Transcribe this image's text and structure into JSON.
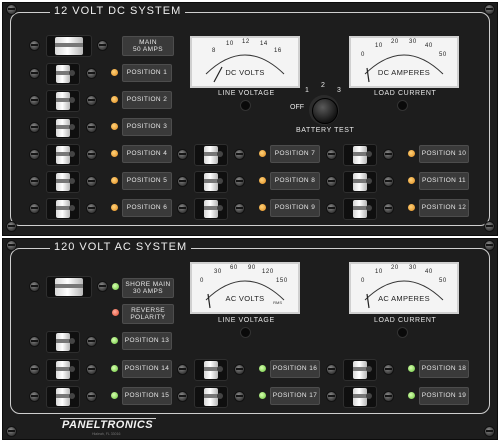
{
  "dc": {
    "title": "12 VOLT DC SYSTEM",
    "main_label_1": "MAIN",
    "main_label_2": "50 AMPS",
    "positions": [
      "POSITION 1",
      "POSITION 2",
      "POSITION 3",
      "POSITION 4",
      "POSITION 5",
      "POSITION 6",
      "POSITION 7",
      "POSITION 8",
      "POSITION 9",
      "POSITION 10",
      "POSITION 11",
      "POSITION 12"
    ],
    "volt_meter": {
      "unit": "DC VOLTS",
      "ticks": [
        "8",
        "10",
        "12",
        "14",
        "16"
      ],
      "caption": "LINE VOLTAGE"
    },
    "amp_meter": {
      "unit": "DC AMPERES",
      "ticks": [
        "0",
        "10",
        "20",
        "30",
        "40",
        "50"
      ],
      "caption": "LOAD CURRENT"
    },
    "battery_test": {
      "caption": "BATTERY TEST",
      "off": "OFF",
      "p1": "1",
      "p2": "2",
      "p3": "3"
    }
  },
  "ac": {
    "title": "120 VOLT AC SYSTEM",
    "shore_1": "SHORE MAIN",
    "shore_2": "30 AMPS",
    "rev_1": "REVERSE",
    "rev_2": "POLARITY",
    "positions": [
      "POSITION 13",
      "POSITION 14",
      "POSITION 15",
      "POSITION 16",
      "POSITION 17",
      "POSITION 18",
      "POSITION 19"
    ],
    "volt_meter": {
      "unit": "AC VOLTS",
      "ticks": [
        "0",
        "30",
        "60",
        "90",
        "120",
        "150"
      ],
      "rms": "RMS",
      "caption": "LINE VOLTAGE"
    },
    "amp_meter": {
      "unit": "AC AMPERES",
      "ticks": [
        "0",
        "10",
        "20",
        "30",
        "40",
        "50"
      ],
      "caption": "LOAD CURRENT"
    }
  },
  "brand": {
    "name": "PANELTRONICS",
    "sub": "Hialeah, FL 33016"
  },
  "colors": {
    "panel": "#1d1d1d",
    "amber_led": "#e08a1c",
    "green_led": "#67c43a",
    "red_led": "#e0452a"
  }
}
